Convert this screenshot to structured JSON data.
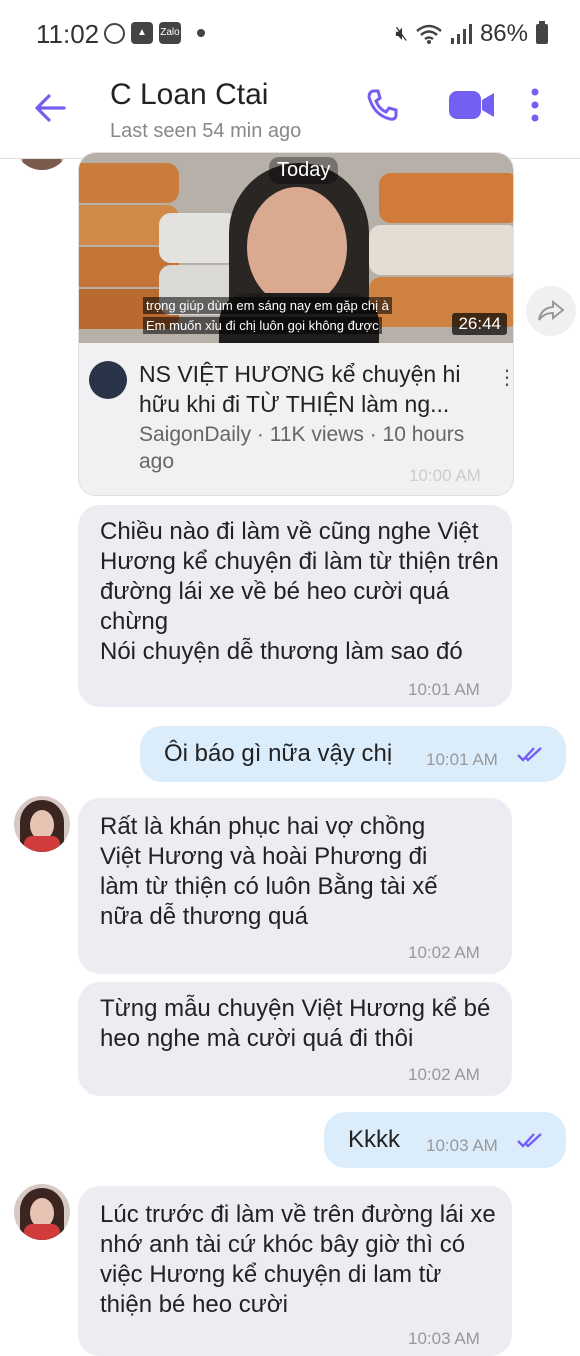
{
  "status_bar": {
    "time": "11:02",
    "app_icons": [
      "viber-icon",
      "gallery-icon",
      "zalo-icon",
      "dot-icon"
    ],
    "zalo_label": "Zalo",
    "battery": "86%"
  },
  "header": {
    "contact_name": "C Loan Ctai",
    "last_seen": "Last seen 54 min ago"
  },
  "link_card": {
    "day_label": "Today",
    "subtitle_line1": "trọng giúp dùm em sáng nay em gặp chị à",
    "subtitle_line2": "Em muốn xỉu đi chị luôn gọi không được",
    "duration": "26:44",
    "title": "NS VIỆT HƯƠNG kể chuyện hi hữu khi đi TỪ THIỆN làm ng...",
    "meta": "SaigonDaily · 11K views · 10 hours ago",
    "time": "10:00 AM"
  },
  "messages": [
    {
      "dir": "in",
      "text": "Chiều nào đi làm về cũng nghe Việt Hương kể chuyện đi làm từ thiện trên đường lái xe về bé heo cười quá chừng\nNói chuyện dễ thương làm sao đó",
      "time": "10:01 AM"
    },
    {
      "dir": "out",
      "text": "Ôi báo gì nữa vậy chị",
      "time": "10:01 AM"
    },
    {
      "dir": "in",
      "text": "Rất là khán phục hai vợ chồng Việt Hương và hoài Phương đi làm từ thiện có luôn Bằng tài xế nữa dễ thương quá",
      "time": "10:02 AM"
    },
    {
      "dir": "in",
      "text": "Từng mẫu chuyện Việt Hương kể bé heo nghe mà cười quá đi thôi",
      "time": "10:02 AM"
    },
    {
      "dir": "out",
      "text": "Kkkk",
      "time": "10:03 AM"
    },
    {
      "dir": "in",
      "text": "Lúc trước đi làm về trên đường lái xe nhớ anh tài cứ khóc bây giờ thì có việc Hương kể chuyện di lam từ thiện bé heo cười",
      "time": "10:03 AM"
    }
  ],
  "colors": {
    "accent": "#7360f2",
    "incoming_bubble": "#ececf2",
    "outgoing_bubble": "#dbecfb"
  }
}
